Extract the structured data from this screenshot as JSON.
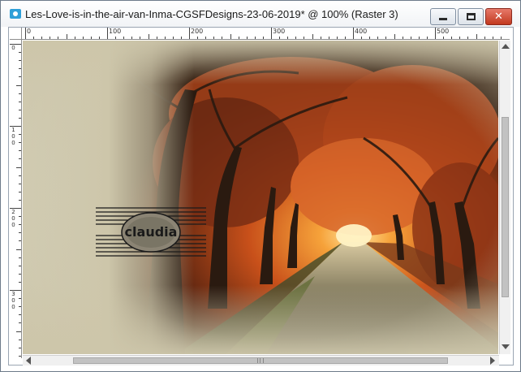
{
  "window": {
    "title": "Les-Love-is-in-the-air-van-Inma-CGSFDesigns-23-06-2019* @ 100% (Raster 3)",
    "icon": "image-document-icon",
    "buttons": {
      "minimize_icon": "minimize-icon",
      "maximize_icon": "maximize-icon",
      "close_glyph": "✕"
    }
  },
  "rulers": {
    "horizontal_labels": [
      "0",
      "100",
      "200",
      "300",
      "400",
      "500"
    ],
    "vertical_labels": [
      [
        "0"
      ],
      [
        "1",
        "0",
        "0"
      ],
      [
        "2",
        "0",
        "0"
      ],
      [
        "3",
        "0",
        "0"
      ]
    ]
  },
  "canvas": {
    "watermark_text": "claudia",
    "accent_colors": {
      "mist": "#cdc6aa",
      "foliage": "#c8501a",
      "glow": "#ffd27a",
      "road": "#6b6550"
    }
  }
}
